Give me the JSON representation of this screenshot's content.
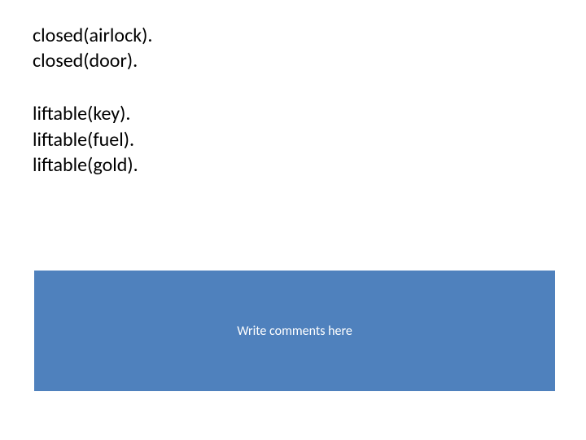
{
  "code": {
    "block1": {
      "line1": "closed(airlock).",
      "line2": "closed(door)."
    },
    "block2": {
      "line1": "liftable(key).",
      "line2": "liftable(fuel).",
      "line3": "liftable(gold)."
    }
  },
  "comment_box": {
    "text": "Write comments here"
  }
}
